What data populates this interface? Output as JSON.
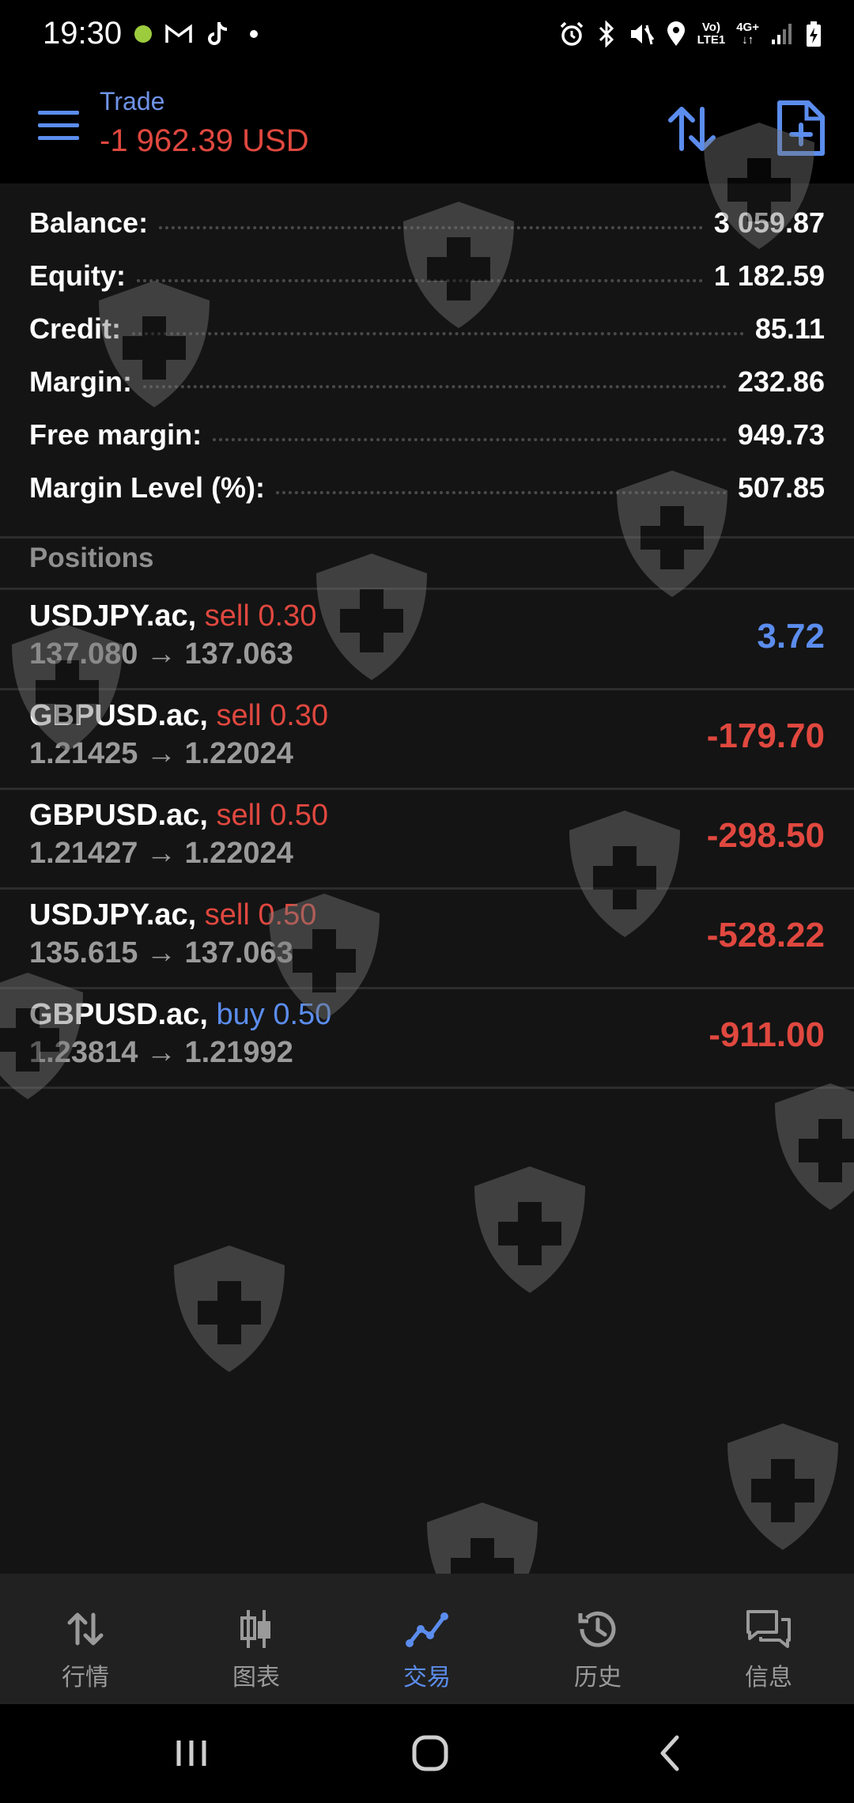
{
  "status_bar": {
    "time": "19:30",
    "network_top": "Vo)",
    "network_bottom": "LTE1",
    "network2_top": "4G+",
    "network2_bottom": "↓↑"
  },
  "header": {
    "title": "Trade",
    "balance": "-1 962.39 USD"
  },
  "summary": [
    {
      "label": "Balance:",
      "value": "3 059.87"
    },
    {
      "label": "Equity:",
      "value": "1 182.59"
    },
    {
      "label": "Credit:",
      "value": "85.11"
    },
    {
      "label": "Margin:",
      "value": "232.86"
    },
    {
      "label": "Free margin:",
      "value": "949.73"
    },
    {
      "label": "Margin Level (%):",
      "value": "507.85"
    }
  ],
  "positions_header": "Positions",
  "positions": [
    {
      "symbol": "USDJPY.ac,",
      "side": "sell 0.30",
      "type": "sell",
      "prices": "137.080 → 137.063",
      "profit": "3.72",
      "profit_sign": "positive"
    },
    {
      "symbol": "GBPUSD.ac,",
      "side": "sell 0.30",
      "type": "sell",
      "prices": "1.21425 → 1.22024",
      "profit": "-179.70",
      "profit_sign": "negative"
    },
    {
      "symbol": "GBPUSD.ac,",
      "side": "sell 0.50",
      "type": "sell",
      "prices": "1.21427 → 1.22024",
      "profit": "-298.50",
      "profit_sign": "negative"
    },
    {
      "symbol": "USDJPY.ac,",
      "side": "sell 0.50",
      "type": "sell",
      "prices": "135.615 → 137.063",
      "profit": "-528.22",
      "profit_sign": "negative"
    },
    {
      "symbol": "GBPUSD.ac,",
      "side": "buy 0.50",
      "type": "buy",
      "prices": "1.23814 → 1.21992",
      "profit": "-911.00",
      "profit_sign": "negative"
    }
  ],
  "bottom_nav": [
    {
      "label": "行情",
      "icon": "quotes-arrows-icon",
      "active": false
    },
    {
      "label": "图表",
      "icon": "candlestick-chart-icon",
      "active": false
    },
    {
      "label": "交易",
      "icon": "trade-line-icon",
      "active": true
    },
    {
      "label": "历史",
      "icon": "history-clock-icon",
      "active": false
    },
    {
      "label": "信息",
      "icon": "messages-icon",
      "active": false
    }
  ],
  "colors": {
    "accent": "#5b8dee",
    "loss": "#e0483f",
    "background": "#141414"
  }
}
